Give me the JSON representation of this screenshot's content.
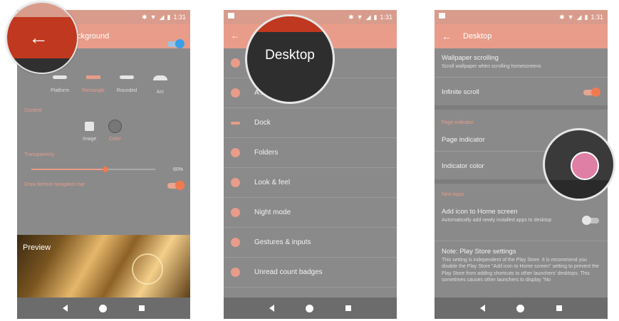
{
  "status": {
    "time": "1:31"
  },
  "phone1": {
    "title": "Background",
    "title_visible": "ckground",
    "shapes": [
      {
        "label": "Platform"
      },
      {
        "label": "Rectangle"
      },
      {
        "label": "Rounded"
      },
      {
        "label": "Arc"
      }
    ],
    "content_label": "Content",
    "content_options": {
      "image": "Image",
      "color": "Color"
    },
    "transparency_label": "Transparency",
    "transparency_value": "60%",
    "transparency_percent": 60,
    "draw_behind_label": "Draw behind navigation bar",
    "preview_label": "Preview"
  },
  "phone2": {
    "magnified_title": "Desktop",
    "items": [
      {
        "label": ""
      },
      {
        "label": "A                  s"
      },
      {
        "label": "Dock"
      },
      {
        "label": "Folders"
      },
      {
        "label": "Look & feel"
      },
      {
        "label": "Night mode"
      },
      {
        "label": "Gestures & inputs"
      },
      {
        "label": "Unread count badges"
      }
    ]
  },
  "phone3": {
    "title": "Desktop",
    "wallpaper_scrolling": {
      "title": "Wallpaper scrolling",
      "subtitle": "Scroll wallpaper when scrolling homescreens"
    },
    "infinite_scroll": {
      "title": "Infinite scroll"
    },
    "page_indicator_section": "Page indicator",
    "page_indicator": {
      "title": "Page indicator"
    },
    "indicator_color": {
      "title": "Indicator color"
    },
    "new_apps_section": "New Apps",
    "add_icon": {
      "title": "Add icon to Home screen",
      "subtitle": "Automatically add newly installed apps to desktop"
    },
    "note": {
      "title": "Note: Play Store settings",
      "body": "This setting is independent of the Play Store. It is recommend you disable the Play Store \"Add icon to Home screen\" setting to prevent the Play Store from adding shortcuts to other launchers' desktops. This sometimes causes other launchers to display \"No"
    },
    "indicator_color_hex": "#e07fa6"
  },
  "colors": {
    "accent": "#e89c89",
    "toggle_on": "#f07a50",
    "toggle_blue": "#39a0e8",
    "magnify_red": "#c0381f"
  }
}
